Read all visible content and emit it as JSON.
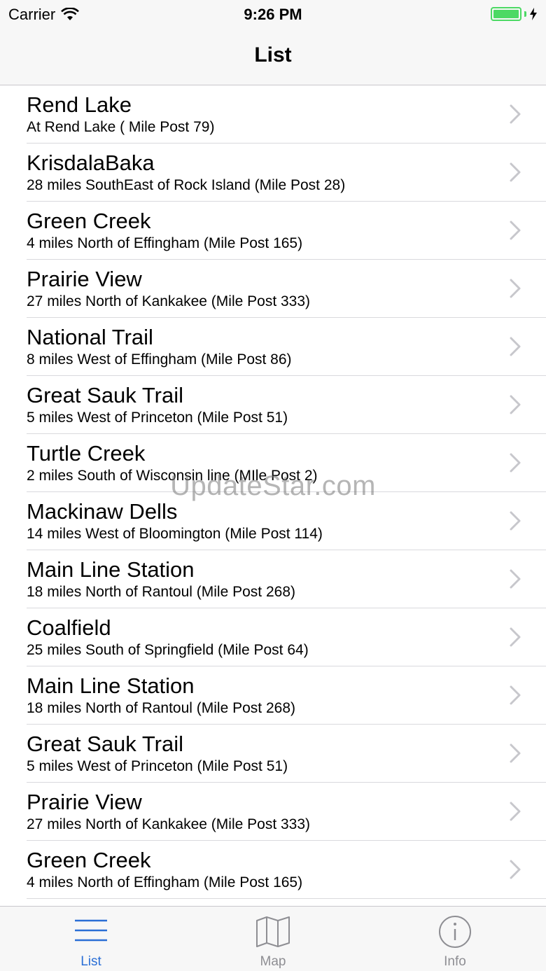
{
  "status_bar": {
    "carrier": "Carrier",
    "time": "9:26 PM",
    "battery_color": "#4cd964"
  },
  "nav_bar": {
    "title": "List"
  },
  "list": {
    "items": [
      {
        "title": "Rend Lake",
        "subtitle": "At Rend Lake ( Mile Post 79)"
      },
      {
        "title": "KrisdalaBaka",
        "subtitle": "28 miles SouthEast of Rock Island (Mile Post 28)"
      },
      {
        "title": "Green Creek",
        "subtitle": "4 miles North of Effingham (Mile Post 165)"
      },
      {
        "title": "Prairie View",
        "subtitle": "27 miles North of Kankakee (Mile Post 333)"
      },
      {
        "title": "National Trail",
        "subtitle": "8 miles West of Effingham (Mile Post 86)"
      },
      {
        "title": "Great Sauk Trail",
        "subtitle": "5 miles West of Princeton (Mile Post 51)"
      },
      {
        "title": "Turtle Creek",
        "subtitle": "2 miles South of Wisconsin line (MIle Post 2)"
      },
      {
        "title": "Mackinaw Dells",
        "subtitle": "14 miles West of Bloomington (Mile Post 114)"
      },
      {
        "title": "Main Line Station",
        "subtitle": "18 miles North of Rantoul (Mile Post 268)"
      },
      {
        "title": "Coalfield",
        "subtitle": "25 miles South of Springfield (Mile Post 64)"
      },
      {
        "title": "Main Line Station",
        "subtitle": "18 miles North of Rantoul (Mile Post 268)"
      },
      {
        "title": "Great Sauk Trail",
        "subtitle": "5 miles West of Princeton (Mile Post 51)"
      },
      {
        "title": "Prairie View",
        "subtitle": "27 miles North of Kankakee (Mile Post 333)"
      },
      {
        "title": "Green Creek",
        "subtitle": "4 miles North of Effingham (Mile Post 165)"
      }
    ]
  },
  "watermark": "UpdateStar.com",
  "tab_bar": {
    "active_color": "#2b6fd6",
    "inactive_color": "#8e8e93",
    "tabs": [
      {
        "label": "List",
        "icon": "list-icon",
        "active": true
      },
      {
        "label": "Map",
        "icon": "map-icon",
        "active": false
      },
      {
        "label": "Info",
        "icon": "info-icon",
        "active": false
      }
    ]
  }
}
